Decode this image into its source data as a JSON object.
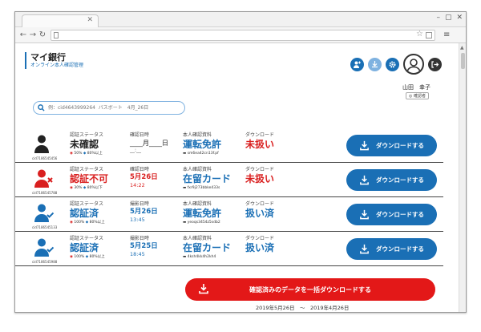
{
  "app": {
    "name": "マイ銀行",
    "subtitle": "オンライン本人確認管理"
  },
  "user": {
    "name": "山田　幸子",
    "role": "確認者"
  },
  "search": {
    "placeholder": "例：cid4643999264  パスポート　4月_26日"
  },
  "labels": {
    "status": "認証ステータス",
    "doc": "本人確認資料",
    "download": "ダウンロード",
    "download_button": "ダウンロードする"
  },
  "rows": [
    {
      "id": "cid7186545456",
      "icon": "user-pending-icon",
      "status": "未確認",
      "status_color": "#222222",
      "score1": "50%",
      "score2": "80%以上",
      "date_label": "確認日時",
      "date": "____月____日",
      "time": "__:__",
      "doc": "運転免許",
      "doc_file": "sm6ea42cn13f.pf",
      "dl_status": "未扱い",
      "dl_color": "#d91f1f"
    },
    {
      "id": "cid7186545788",
      "icon": "user-rejected-icon",
      "status": "認証不可",
      "status_color": "#d91f1f",
      "score1": "30%",
      "score2": "80%以下",
      "date_label": "確認日時",
      "date": "5月26日",
      "time": "14:22",
      "doc": "在留カード",
      "doc_file": "fxr9j273bbke433s",
      "dl_status": "未扱い",
      "dl_color": "#d91f1f"
    },
    {
      "id": "cid7186545133",
      "icon": "user-verified-icon",
      "status": "認証済",
      "status_color": "#1a6fb5",
      "score1": "100%",
      "score2": "80%以上",
      "date_label": "撮影日時",
      "date": "5月26日",
      "time": "13:45",
      "doc": "運転免許",
      "doc_file": "yeoqs3454z5sdb2",
      "dl_status": "扱い済",
      "dl_color": "#1a6fb5"
    },
    {
      "id": "cid7186545988",
      "icon": "user-verified-icon",
      "status": "認証済",
      "status_color": "#1a6fb5",
      "score1": "100%",
      "score2": "80%以上",
      "date_label": "撮影日時",
      "date": "5月25日",
      "time": "18:45",
      "doc": "在留カード",
      "doc_file": "4ksh4kk4h2kh4",
      "dl_status": "扱い済",
      "dl_color": "#1a6fb5"
    }
  ],
  "bulk": {
    "label": "確認済みのデータを一括ダウンロードする"
  },
  "range": "2019年5月26日　〜　2019年4月26日",
  "colors": {
    "accent": "#1a6fb5",
    "danger": "#e31818",
    "light_accent": "#7fb2e0"
  }
}
